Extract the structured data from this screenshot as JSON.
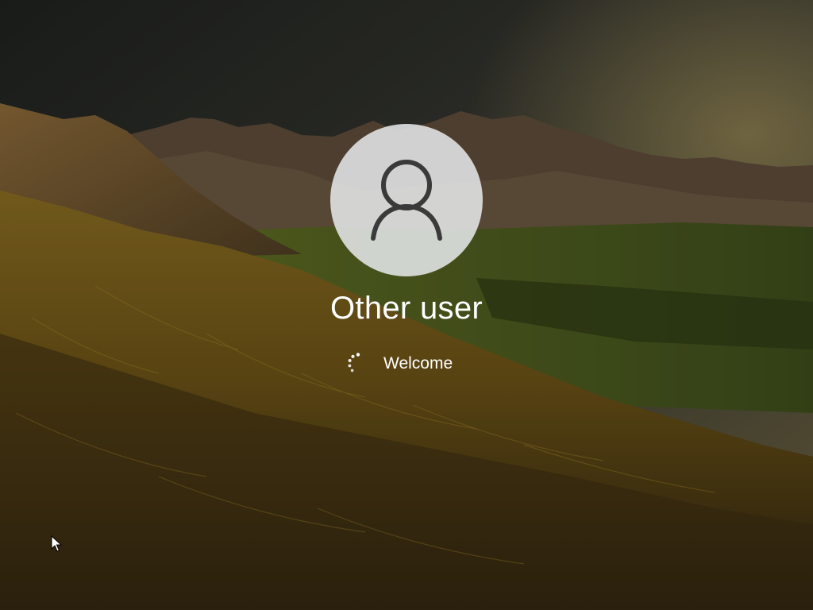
{
  "lock_screen": {
    "user": {
      "name": "Other user",
      "avatar_icon": "generic-user-icon"
    },
    "status": {
      "text": "Welcome",
      "indicator_icon": "loading-spinner-icon"
    }
  },
  "pointer": {
    "icon": "mouse-pointer-icon"
  },
  "colors": {
    "text": "#ffffff",
    "avatar_background": "#e8eaec",
    "avatar_glyph": "#3a3a3a"
  }
}
